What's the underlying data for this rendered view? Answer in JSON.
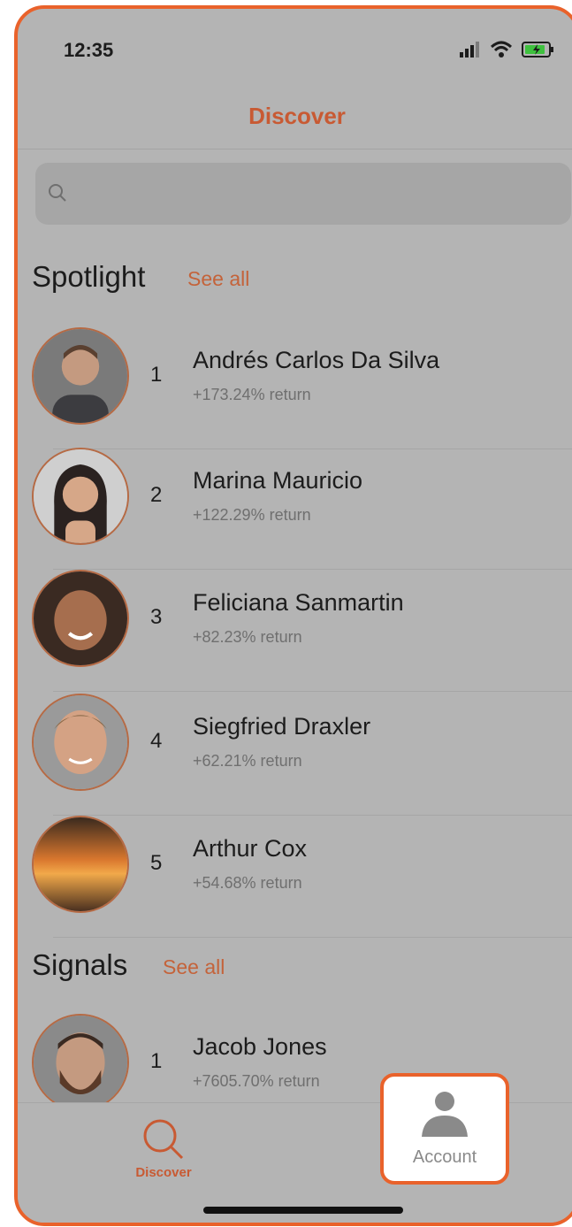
{
  "status": {
    "time": "12:35"
  },
  "nav": {
    "title": "Discover"
  },
  "search": {
    "placeholder": ""
  },
  "spotlight": {
    "title": "Spotlight",
    "see_all": "See all",
    "items": [
      {
        "rank": "1",
        "name": "Andrés Carlos Da Silva",
        "return": "+173.24% return"
      },
      {
        "rank": "2",
        "name": "Marina Mauricio",
        "return": "+122.29% return"
      },
      {
        "rank": "3",
        "name": "Feliciana Sanmartin",
        "return": "+82.23% return"
      },
      {
        "rank": "4",
        "name": "Siegfried Draxler",
        "return": "+62.21% return"
      },
      {
        "rank": "5",
        "name": "Arthur Cox",
        "return": "+54.68% return"
      }
    ]
  },
  "signals": {
    "title": "Signals",
    "see_all": "See all",
    "items": [
      {
        "rank": "1",
        "name": "Jacob Jones",
        "return": "+7605.70% return"
      }
    ]
  },
  "tabbar": {
    "discover_label": "Discover",
    "account_label": "Account"
  },
  "colors": {
    "accent": "#e9622b",
    "title": "#c85a33",
    "background": "#b4b4b4"
  },
  "icons": [
    "search-icon",
    "signal-icon",
    "wifi-icon",
    "battery-icon",
    "user-icon"
  ]
}
